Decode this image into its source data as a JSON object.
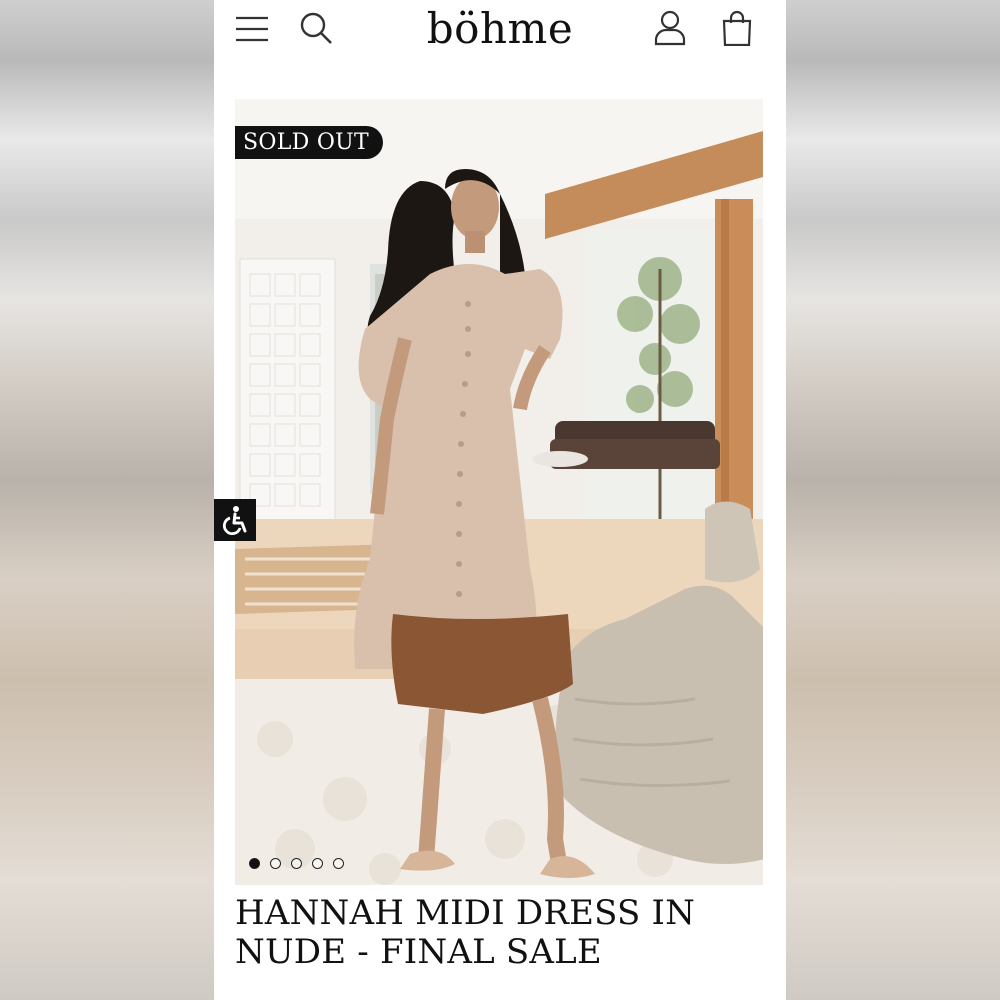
{
  "header": {
    "logo": "böhme",
    "menu_icon": "hamburger-menu-icon",
    "search_icon": "search-icon",
    "account_icon": "user-account-icon",
    "cart_icon": "shopping-bag-icon"
  },
  "product": {
    "badge": "SOLD OUT",
    "title": "HANNAH MIDI DRESS IN NUDE - FINAL SALE",
    "gallery": {
      "image_count": 5,
      "active_index": 0
    }
  },
  "accessibility_button": {
    "icon": "accessibility-wheelchair-icon"
  },
  "colors": {
    "dress": "#d8c0ac",
    "dress_hem": "#8b5634",
    "badge_bg": "#111111",
    "text": "#111111"
  }
}
